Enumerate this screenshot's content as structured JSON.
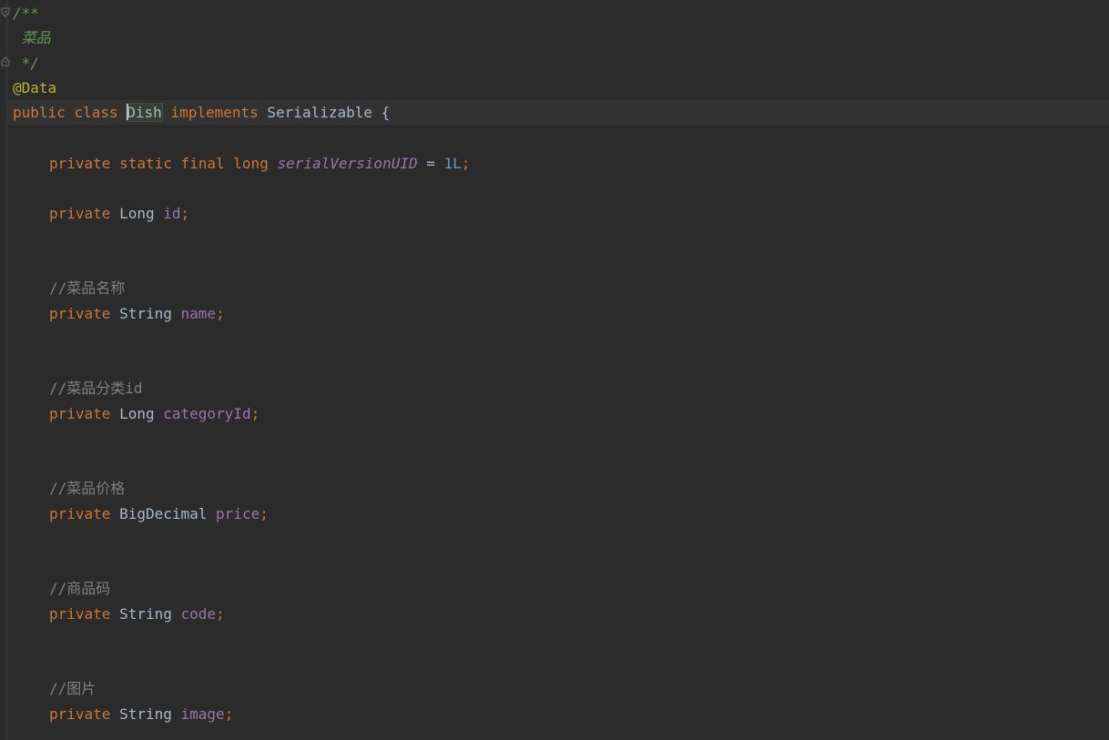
{
  "doc_comment": {
    "open": "/**",
    "text": " 菜品",
    "close": " */"
  },
  "annotation": "@Data",
  "class_decl": {
    "public_kw": "public",
    "class_kw": "class",
    "name_first": "D",
    "name_rest": "ish",
    "implements_kw": "implements",
    "interface": "Serializable",
    "brace": "{"
  },
  "serial": {
    "mods": "private static final long",
    "name": "serialVersionUID",
    "eq": "=",
    "value": "1L",
    "semi": ";"
  },
  "fields": [
    {
      "comment": "",
      "modifier": "private",
      "type": "Long",
      "name": "id",
      "semi": ";"
    },
    {
      "comment": "//菜品名称",
      "modifier": "private",
      "type": "String",
      "name": "name",
      "semi": ";"
    },
    {
      "comment": "//菜品分类id",
      "modifier": "private",
      "type": "Long",
      "name": "categoryId",
      "semi": ";"
    },
    {
      "comment": "//菜品价格",
      "modifier": "private",
      "type": "BigDecimal",
      "name": "price",
      "semi": ";"
    },
    {
      "comment": "//商品码",
      "modifier": "private",
      "type": "String",
      "name": "code",
      "semi": ";"
    },
    {
      "comment": "//图片",
      "modifier": "private",
      "type": "String",
      "name": "image",
      "semi": ";"
    }
  ]
}
